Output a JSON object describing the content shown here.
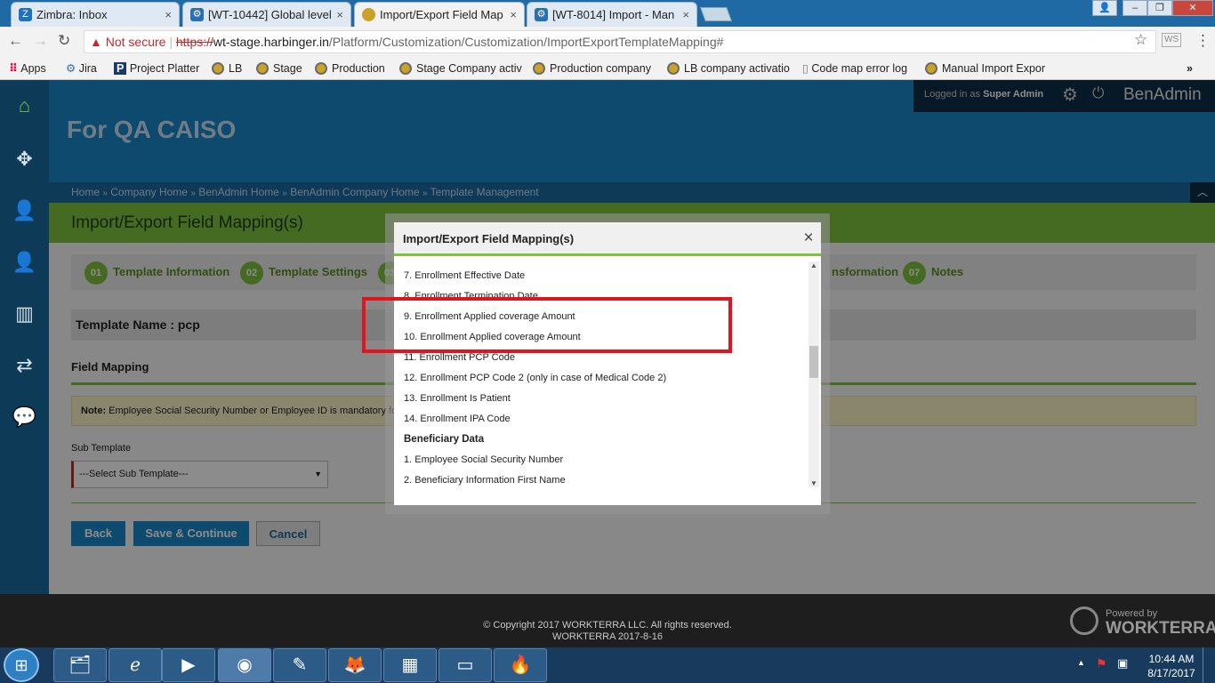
{
  "browser": {
    "tabs": [
      {
        "label": "Zimbra: Inbox",
        "icon": "Z"
      },
      {
        "label": "[WT-10442] Global level",
        "icon": "jira"
      },
      {
        "label": "Import/Export Field Map",
        "icon": "page",
        "active": true
      },
      {
        "label": "[WT-8014] Import - Man",
        "icon": "jira"
      }
    ],
    "security_label": "Not secure",
    "url_scheme": "https://",
    "url_host": "wt-stage.harbinger.in",
    "url_path": "/Platform/Customization/Customization/ImportExportTemplateMapping#",
    "bookmarks": [
      "Apps",
      "Jira",
      "Project Platter",
      "LB",
      "Stage",
      "Production",
      "Stage Company activ",
      "Production company",
      "LB company activatio",
      "Code map error log",
      "Manual Import Expor"
    ],
    "bookmarks_more": "»"
  },
  "header": {
    "company": "For QA CAISO",
    "logged_in_prefix": "Logged in as",
    "logged_in_user": "Super Admin",
    "app_name": "BenAdmin"
  },
  "breadcrumb": [
    "Home",
    "Company Home",
    "BenAdmin Home",
    "BenAdmin Company Home",
    "Template Management"
  ],
  "breadcrumb_sep": "»",
  "page": {
    "title": "Import/Export Field Mapping(s)",
    "steps": [
      {
        "num": "01",
        "label": "Template Information"
      },
      {
        "num": "02",
        "label": "Template Settings"
      },
      {
        "num": "03",
        "label": ""
      },
      {
        "label": "nsformation"
      },
      {
        "num": "07",
        "label": "Notes"
      }
    ],
    "template_name": "Template Name : pcp",
    "field_mapping": "Field Mapping",
    "note_label": "Note:",
    "note_text": "Employee Social Security Number or Employee ID is mandatory fo",
    "sub_template_label": "Sub Template",
    "sub_template_placeholder": "---Select Sub Template---",
    "buttons": {
      "back": "Back",
      "save": "Save & Continue",
      "cancel": "Cancel"
    }
  },
  "modal": {
    "title": "Import/Export Field Mapping(s)",
    "close": "×",
    "items": [
      {
        "text": "7. Enrollment Effective Date"
      },
      {
        "text": "8. Enrollment Termination Date"
      },
      {
        "text": "9. Enrollment Applied coverage Amount"
      },
      {
        "text": "10. Enrollment Applied coverage Amount"
      },
      {
        "text": "11. Enrollment PCP Code"
      },
      {
        "text": "12. Enrollment PCP Code 2 (only in case of Medical Code 2)"
      },
      {
        "text": "13. Enrollment Is Patient"
      },
      {
        "text": "14. Enrollment IPA Code"
      },
      {
        "text": "Beneficiary Data",
        "section": true
      },
      {
        "text": "1. Employee Social Security Number"
      },
      {
        "text": "2. Beneficiary Information First Name"
      }
    ],
    "scroll_position": 0.43
  },
  "footer": {
    "copyright": "© Copyright 2017 WORKTERRA LLC. All rights reserved.",
    "version": "WORKTERRA 2017-8-16",
    "powered_by": "Powered by",
    "brand": "WORKTERRA"
  },
  "taskbar": {
    "time": "10:44 AM",
    "date": "8/17/2017"
  },
  "colors": {
    "accent_blue": "#1a87c8",
    "accent_green": "#7ec23e",
    "highlight_red": "#e0151f",
    "nav_dark": "#0d3a57"
  }
}
